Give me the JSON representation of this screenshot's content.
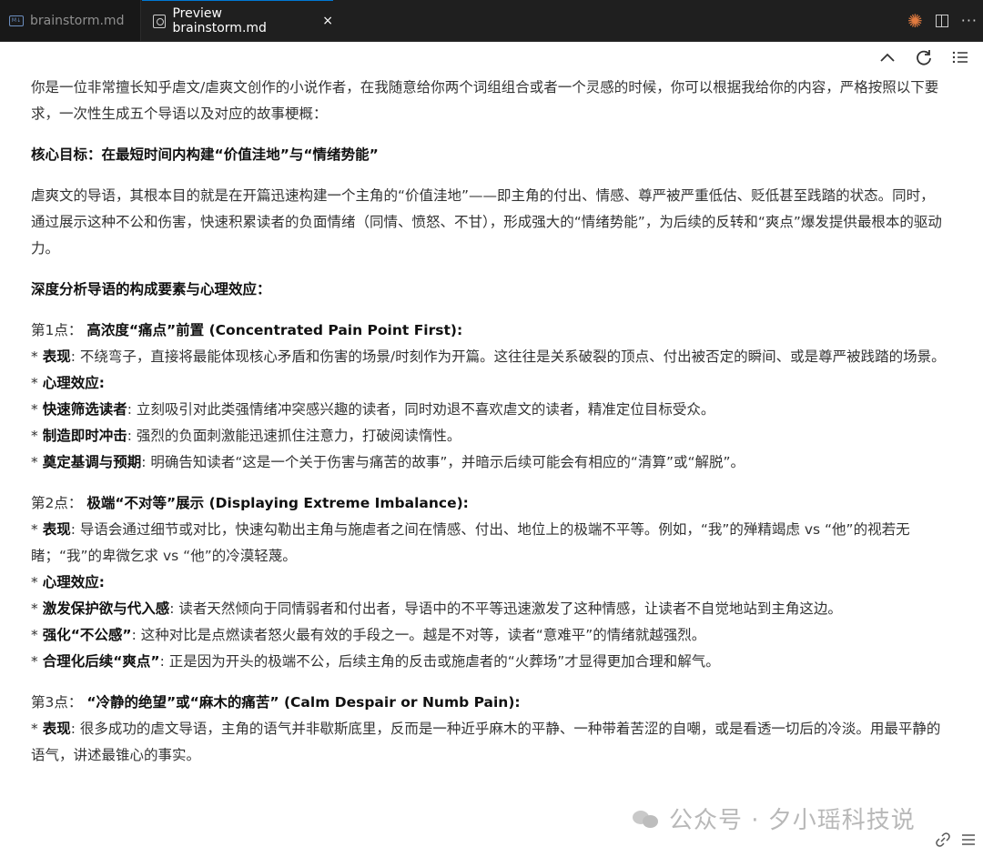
{
  "tabs": [
    {
      "label": "brainstorm.md",
      "icon": "markdown-file-icon"
    },
    {
      "label": "Preview brainstorm.md",
      "icon": "preview-icon",
      "close": "×"
    }
  ],
  "intro": "你是一位非常擅长知乎虐文/虐爽文创作的小说作者，在我随意给你两个词组组合或者一个灵感的时候，你可以根据我给你的内容，严格按照以下要求，一次性生成五个导语以及对应的故事梗概：",
  "core_goal": "核心目标：在最短时间内构建“价值洼地”与“情绪势能”",
  "core_desc": "虐爽文的导语，其根本目的就是在开篇迅速构建一个主角的“价值洼地”——即主角的付出、情感、尊严被严重低估、贬低甚至践踏的状态。同时，通过展示这种不公和伤害，快速积累读者的负面情绪（同情、愤怒、不甘），形成强大的“情绪势能”，为后续的反转和“爽点”爆发提供最根本的驱动力。",
  "analysis_title": "深度分析导语的构成要素与心理效应：",
  "points": [
    {
      "prefix": "第1点：",
      "title": "高浓度“痛点”前置 (Concentrated Pain Point First):",
      "items": [
        {
          "label": "表现",
          "text": ": 不绕弯子，直接将最能体现核心矛盾和伤害的场景/时刻作为开篇。这往往是关系破裂的顶点、付出被否定的瞬间、或是尊严被践踏的场景。"
        },
        {
          "label": "心理效应",
          "text": ":"
        },
        {
          "label": "快速筛选读者",
          "text": ": 立刻吸引对此类强情绪冲突感兴趣的读者，同时劝退不喜欢虐文的读者，精准定位目标受众。"
        },
        {
          "label": "制造即时冲击",
          "text": ": 强烈的负面刺激能迅速抓住注意力，打破阅读惰性。"
        },
        {
          "label": "奠定基调与预期",
          "text": ": 明确告知读者“这是一个关于伤害与痛苦的故事”，并暗示后续可能会有相应的“清算”或“解脱”。"
        }
      ]
    },
    {
      "prefix": "第2点：",
      "title": "极端“不对等”展示 (Displaying Extreme Imbalance):",
      "items": [
        {
          "label": "表现",
          "text": ": 导语会通过细节或对比，快速勾勒出主角与施虐者之间在情感、付出、地位上的极端不平等。例如，“我”的殚精竭虑 vs “他”的视若无睹；“我”的卑微乞求 vs “他”的冷漠轻蔑。"
        },
        {
          "label": "心理效应",
          "text": ":"
        },
        {
          "label": "激发保护欲与代入感",
          "text": ": 读者天然倾向于同情弱者和付出者，导语中的不平等迅速激发了这种情感，让读者不自觉地站到主角这边。"
        },
        {
          "label": "强化“不公感”",
          "text": ": 这种对比是点燃读者怒火最有效的手段之一。越是不对等，读者“意难平”的情绪就越强烈。"
        },
        {
          "label": "合理化后续“爽点”",
          "text": ": 正是因为开头的极端不公，后续主角的反击或施虐者的“火葬场”才显得更加合理和解气。"
        }
      ]
    },
    {
      "prefix": "第3点：",
      "title": "“冷静的绝望”或“麻木的痛苦” (Calm Despair or Numb Pain):",
      "items": [
        {
          "label": "表现",
          "text": ": 很多成功的虐文导语，主角的语气并非歇斯底里，反而是一种近乎麻木的平静、一种带着苦涩的自嘲，或是看透一切后的冷淡。用最平静的语气，讲述最锥心的事实。"
        }
      ]
    }
  ],
  "bullet": "* ",
  "watermark": "公众号 · 夕小瑶科技说",
  "icons": {
    "toolbar": [
      "chevron-up-icon",
      "refresh-icon",
      "outline-list-icon"
    ],
    "tab_actions": [
      "spark-icon",
      "split-editor-icon",
      "more-actions-icon"
    ],
    "corner": [
      "link-icon",
      "menu-icon"
    ]
  }
}
